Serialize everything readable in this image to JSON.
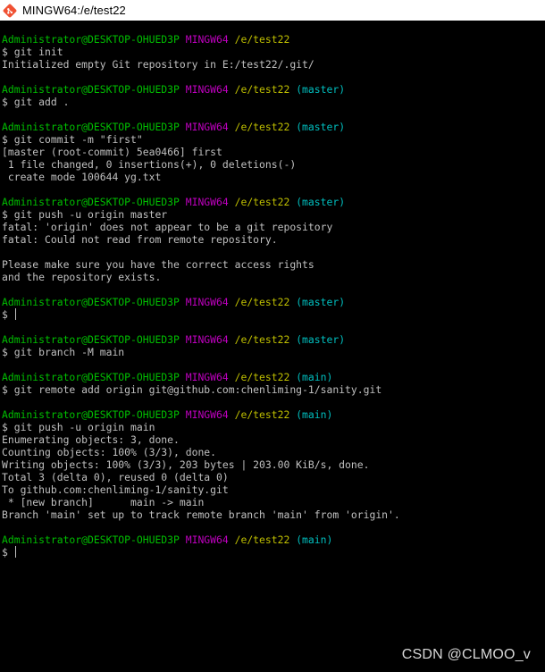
{
  "window": {
    "title": "MINGW64:/e/test22",
    "icon": "git-bash-icon"
  },
  "colors": {
    "background": "#000000",
    "text": "#c0c0c0",
    "user": "#00bf00",
    "system": "#bf00bf",
    "path": "#bfbf00",
    "branch": "#00bfbf"
  },
  "terminal": {
    "lines": [
      [
        [
          "user",
          "Administrator@DESKTOP-OHUED3P"
        ],
        [
          "text",
          " "
        ],
        [
          "sys",
          "MINGW64"
        ],
        [
          "text",
          " "
        ],
        [
          "path",
          "/e/test22"
        ]
      ],
      [
        [
          "text",
          "$ git init"
        ]
      ],
      [
        [
          "text",
          "Initialized empty Git repository in E:/test22/.git/"
        ]
      ],
      [],
      [
        [
          "user",
          "Administrator@DESKTOP-OHUED3P"
        ],
        [
          "text",
          " "
        ],
        [
          "sys",
          "MINGW64"
        ],
        [
          "text",
          " "
        ],
        [
          "path",
          "/e/test22"
        ],
        [
          "text",
          " "
        ],
        [
          "branch",
          "(master)"
        ]
      ],
      [
        [
          "text",
          "$ git add ."
        ]
      ],
      [],
      [
        [
          "user",
          "Administrator@DESKTOP-OHUED3P"
        ],
        [
          "text",
          " "
        ],
        [
          "sys",
          "MINGW64"
        ],
        [
          "text",
          " "
        ],
        [
          "path",
          "/e/test22"
        ],
        [
          "text",
          " "
        ],
        [
          "branch",
          "(master)"
        ]
      ],
      [
        [
          "text",
          "$ git commit -m \"first\""
        ]
      ],
      [
        [
          "text",
          "[master (root-commit) 5ea0466] first"
        ]
      ],
      [
        [
          "text",
          " 1 file changed, 0 insertions(+), 0 deletions(-)"
        ]
      ],
      [
        [
          "text",
          " create mode 100644 yg.txt"
        ]
      ],
      [],
      [
        [
          "user",
          "Administrator@DESKTOP-OHUED3P"
        ],
        [
          "text",
          " "
        ],
        [
          "sys",
          "MINGW64"
        ],
        [
          "text",
          " "
        ],
        [
          "path",
          "/e/test22"
        ],
        [
          "text",
          " "
        ],
        [
          "branch",
          "(master)"
        ]
      ],
      [
        [
          "text",
          "$ git push -u origin master"
        ]
      ],
      [
        [
          "text",
          "fatal: 'origin' does not appear to be a git repository"
        ]
      ],
      [
        [
          "text",
          "fatal: Could not read from remote repository."
        ]
      ],
      [],
      [
        [
          "text",
          "Please make sure you have the correct access rights"
        ]
      ],
      [
        [
          "text",
          "and the repository exists."
        ]
      ],
      [],
      [
        [
          "user",
          "Administrator@DESKTOP-OHUED3P"
        ],
        [
          "text",
          " "
        ],
        [
          "sys",
          "MINGW64"
        ],
        [
          "text",
          " "
        ],
        [
          "path",
          "/e/test22"
        ],
        [
          "text",
          " "
        ],
        [
          "branch",
          "(master)"
        ]
      ],
      [
        [
          "text",
          "$ "
        ],
        [
          "cursor",
          ""
        ]
      ],
      [],
      [
        [
          "user",
          "Administrator@DESKTOP-OHUED3P"
        ],
        [
          "text",
          " "
        ],
        [
          "sys",
          "MINGW64"
        ],
        [
          "text",
          " "
        ],
        [
          "path",
          "/e/test22"
        ],
        [
          "text",
          " "
        ],
        [
          "branch",
          "(master)"
        ]
      ],
      [
        [
          "text",
          "$ git branch -M main"
        ]
      ],
      [],
      [
        [
          "user",
          "Administrator@DESKTOP-OHUED3P"
        ],
        [
          "text",
          " "
        ],
        [
          "sys",
          "MINGW64"
        ],
        [
          "text",
          " "
        ],
        [
          "path",
          "/e/test22"
        ],
        [
          "text",
          " "
        ],
        [
          "branch",
          "(main)"
        ]
      ],
      [
        [
          "text",
          "$ git remote add origin git@github.com:chenliming-1/sanity.git"
        ]
      ],
      [],
      [
        [
          "user",
          "Administrator@DESKTOP-OHUED3P"
        ],
        [
          "text",
          " "
        ],
        [
          "sys",
          "MINGW64"
        ],
        [
          "text",
          " "
        ],
        [
          "path",
          "/e/test22"
        ],
        [
          "text",
          " "
        ],
        [
          "branch",
          "(main)"
        ]
      ],
      [
        [
          "text",
          "$ git push -u origin main"
        ]
      ],
      [
        [
          "text",
          "Enumerating objects: 3, done."
        ]
      ],
      [
        [
          "text",
          "Counting objects: 100% (3/3), done."
        ]
      ],
      [
        [
          "text",
          "Writing objects: 100% (3/3), 203 bytes | 203.00 KiB/s, done."
        ]
      ],
      [
        [
          "text",
          "Total 3 (delta 0), reused 0 (delta 0)"
        ]
      ],
      [
        [
          "text",
          "To github.com:chenliming-1/sanity.git"
        ]
      ],
      [
        [
          "text",
          " * [new branch]      main -> main"
        ]
      ],
      [
        [
          "text",
          "Branch 'main' set up to track remote branch 'main' from 'origin'."
        ]
      ],
      [],
      [
        [
          "user",
          "Administrator@DESKTOP-OHUED3P"
        ],
        [
          "text",
          " "
        ],
        [
          "sys",
          "MINGW64"
        ],
        [
          "text",
          " "
        ],
        [
          "path",
          "/e/test22"
        ],
        [
          "text",
          " "
        ],
        [
          "branch",
          "(main)"
        ]
      ],
      [
        [
          "text",
          "$ "
        ],
        [
          "cursor",
          ""
        ]
      ]
    ]
  },
  "watermark": "CSDN @CLMOO_v"
}
